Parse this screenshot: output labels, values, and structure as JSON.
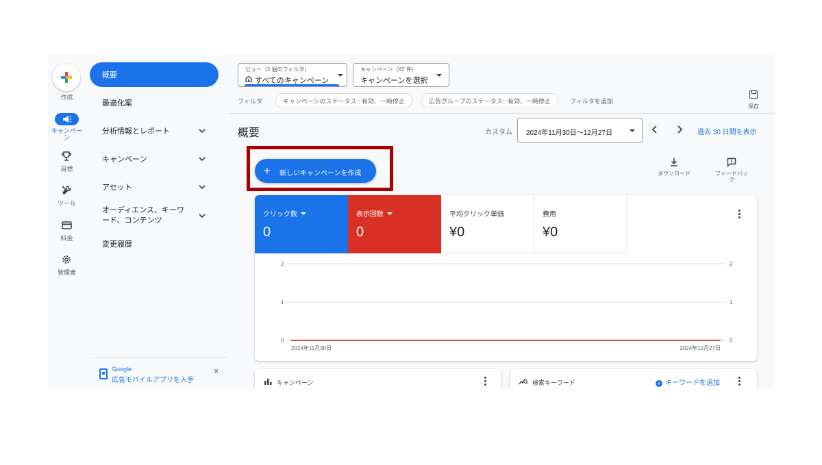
{
  "rail": {
    "create_label": "作成",
    "items": [
      {
        "icon": "megaphone-icon",
        "label": "キャンペー\nン",
        "active": true
      },
      {
        "icon": "trophy-icon",
        "label": "目標"
      },
      {
        "icon": "tools-icon",
        "label": "ツール"
      },
      {
        "icon": "billing-card-icon",
        "label": "料金"
      },
      {
        "icon": "gear-icon",
        "label": "管理者"
      }
    ]
  },
  "nav": {
    "items": [
      {
        "label": "概要",
        "active": true
      },
      {
        "label": "最適化案"
      },
      {
        "label": "分析情報とレポート",
        "expandable": true
      },
      {
        "label": "キャンペーン",
        "expandable": true
      },
      {
        "label": "アセット",
        "expandable": true
      },
      {
        "label": "オーディエンス、キーワード、コンテンツ",
        "expandable": true
      },
      {
        "label": "変更履歴"
      }
    ],
    "promo": {
      "line1": "Google",
      "line2": "広告モバイルアプリを入手",
      "close": "×"
    }
  },
  "toolbar": {
    "view": {
      "small": "ビュー（2 個のフィルタ）",
      "value": "すべてのキャンペーン"
    },
    "campaign": {
      "small": "キャンペーン（62 件）",
      "value": "キャンペーンを選択"
    }
  },
  "filters": {
    "label": "フィルタ",
    "chips": [
      "キャンペーンのステータス:: 有効、一時停止",
      "広告グループのステータス:: 有効、一時停止"
    ],
    "add": "フィルタを追加",
    "save": "保存"
  },
  "header": {
    "title": "概要",
    "custom_label": "カスタム",
    "date_range": "2024年11月30日〜12月27日",
    "last30": "過去 30 日間を表示"
  },
  "actions": {
    "new_campaign": "新しいキャンペーンを作成",
    "download": "ダウンロード",
    "feedback": "フィードバッ\nク"
  },
  "metrics": [
    {
      "label": "クリック数",
      "value": "0",
      "color": "#1a73e8",
      "dropdown": true
    },
    {
      "label": "表示回数",
      "value": "0",
      "color": "#d93025",
      "dropdown": true
    },
    {
      "label": "平均クリック単価",
      "value": "¥0"
    },
    {
      "label": "費用",
      "value": "¥0"
    }
  ],
  "chart_data": {
    "type": "line",
    "x_labels": [
      "2024年11月30日",
      "2024年12月27日"
    ],
    "y_ticks": [
      0,
      1,
      2
    ],
    "ylim": [
      0,
      2
    ],
    "series": [
      {
        "name": "クリック数",
        "color": "#1a73e8",
        "values": [
          0,
          0
        ]
      },
      {
        "name": "表示回数",
        "color": "#d93025",
        "values": [
          0,
          0
        ]
      }
    ]
  },
  "bottom_cards": {
    "campaigns_title": "キャンペーン",
    "keywords_title": "検索キーワード",
    "add_keyword": "キーワードを追加"
  }
}
